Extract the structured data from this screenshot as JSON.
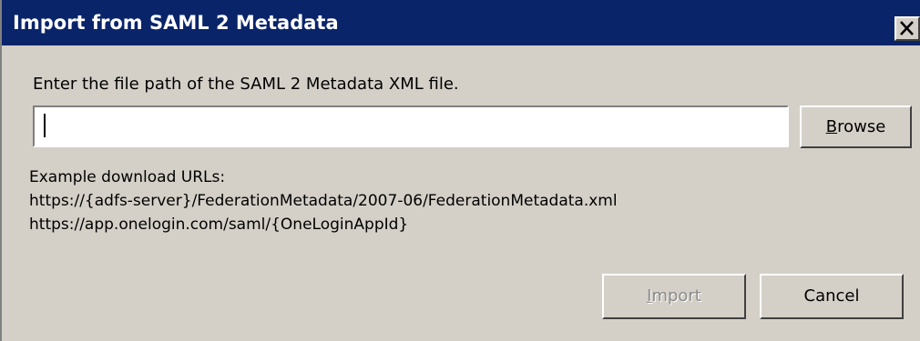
{
  "window": {
    "title": "Import from SAML 2 Metadata",
    "close_icon": "close-x-icon"
  },
  "form": {
    "instruction": "Enter the file path of the SAML 2 Metadata XML file.",
    "file_path_value": "",
    "browse_label_accel": "B",
    "browse_label_rest": "rowse"
  },
  "examples": {
    "heading": "Example download URLs:",
    "urls": [
      "https://{adfs-server}/FederationMetadata/2007-06/FederationMetadata.xml",
      "https://app.onelogin.com/saml/{OneLoginAppId}"
    ]
  },
  "buttons": {
    "import_label_accel": "I",
    "import_label_rest": "mport",
    "import_enabled": false,
    "cancel_label": "Cancel"
  },
  "colors": {
    "titlebar": "#0a246a",
    "dialog_face": "#d4d0c8",
    "disabled_text": "#8a8a8a"
  }
}
